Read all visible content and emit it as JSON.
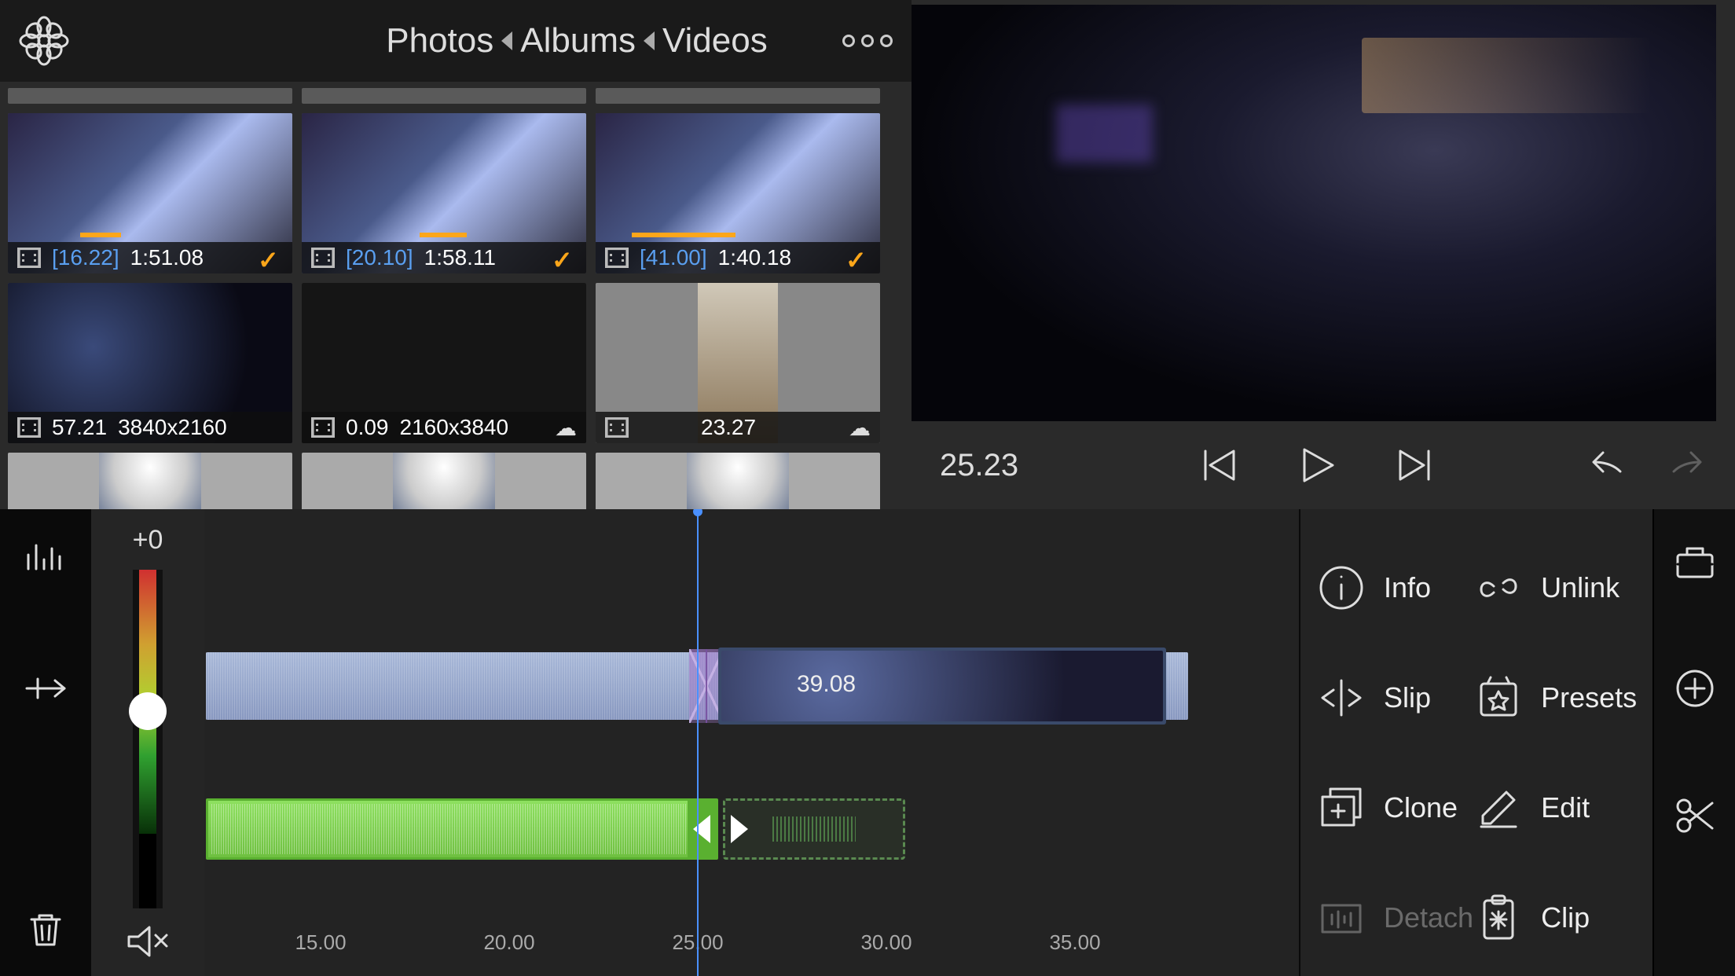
{
  "breadcrumb": {
    "l1": "Photos",
    "l2": "Albums",
    "l3": "Videos"
  },
  "thumbs_r1": [
    {
      "sel": "[16.22]",
      "dur": "1:51.08",
      "mark": true,
      "check": true
    },
    {
      "sel": "[20.10]",
      "dur": "1:58.11",
      "mark": true,
      "check": true
    },
    {
      "sel": "[41.00]",
      "dur": "1:40.18",
      "mark": true,
      "check": true
    }
  ],
  "thumbs_r2": [
    {
      "dur": "57.21",
      "res": "3840x2160"
    },
    {
      "dur": "0.09",
      "res": "2160x3840",
      "cloud": true
    },
    {
      "dur": "23.27",
      "cloud": true
    }
  ],
  "playback": {
    "time": "25.23"
  },
  "vol": {
    "value": "+0"
  },
  "clip2_dur": "39.08",
  "ruler": [
    "15.00",
    "20.00",
    "25.00",
    "30.00",
    "35.00"
  ],
  "actions": {
    "info": "Info",
    "unlink": "Unlink",
    "slip": "Slip",
    "presets": "Presets",
    "clone": "Clone",
    "edit": "Edit",
    "detach": "Detach",
    "clip": "Clip"
  }
}
